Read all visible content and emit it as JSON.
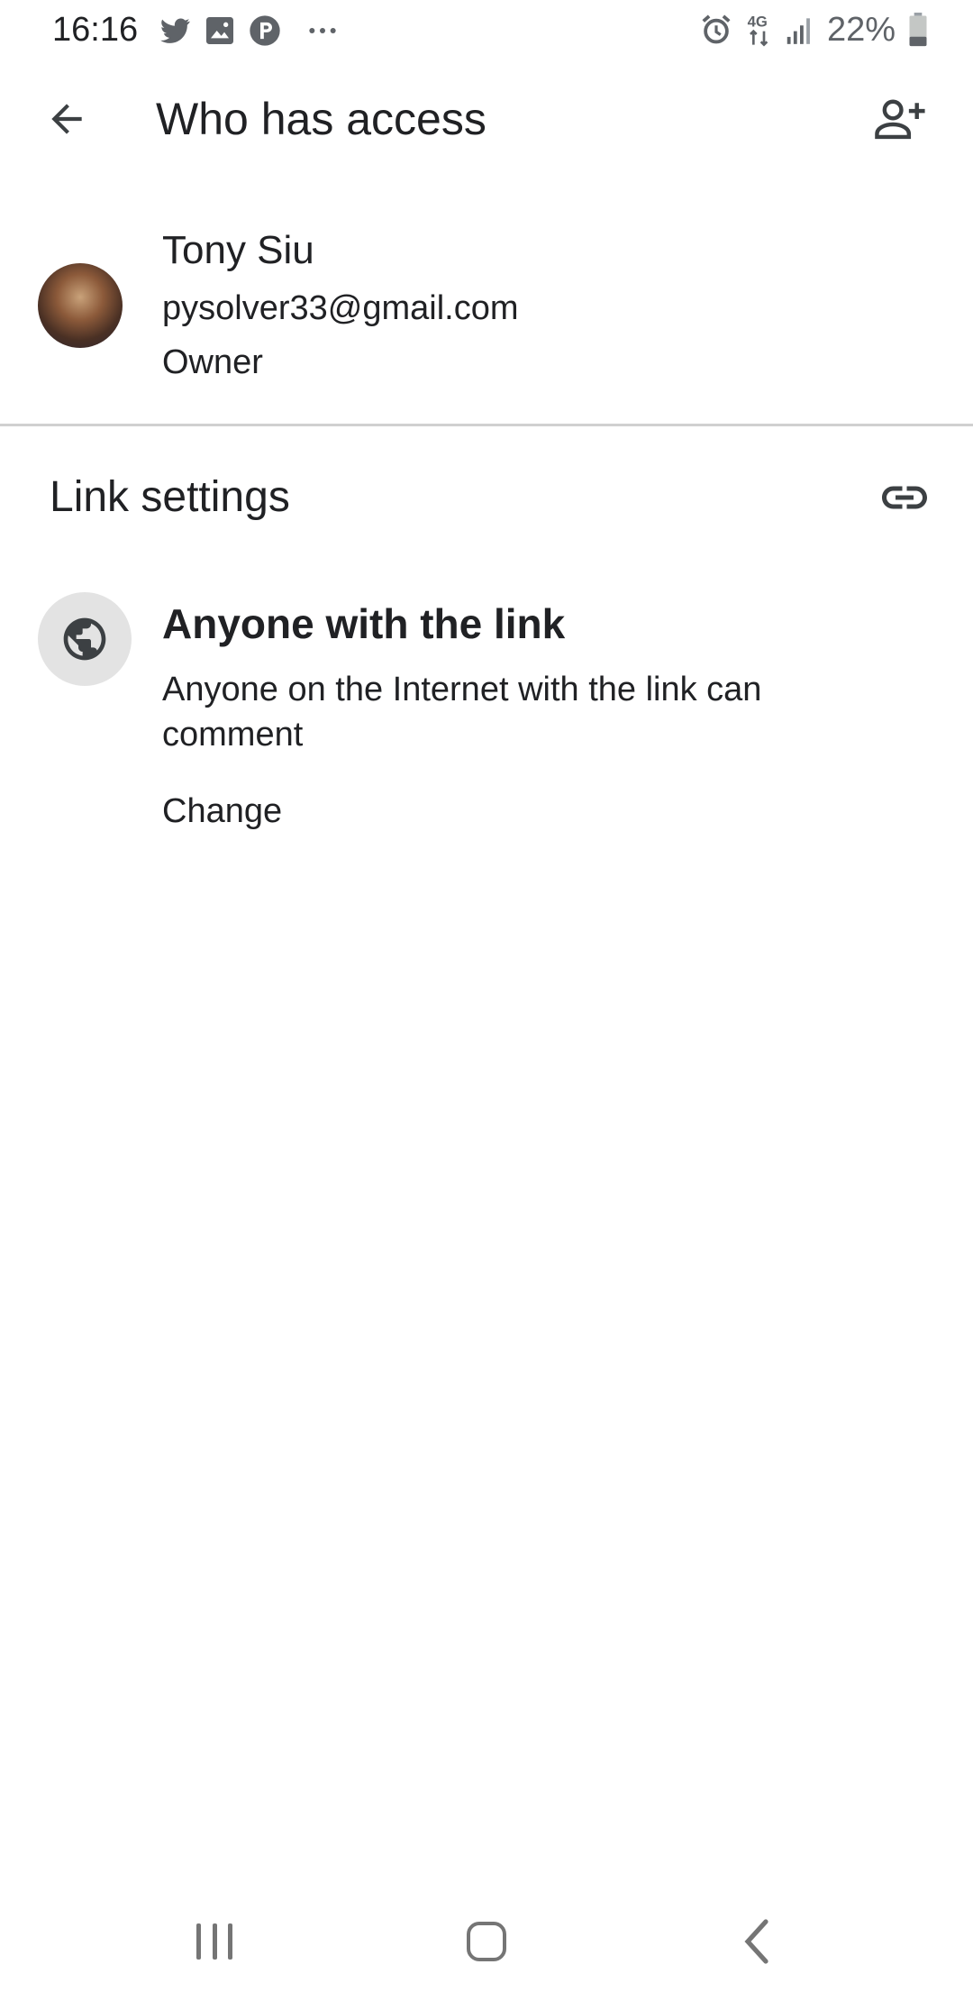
{
  "status_bar": {
    "time": "16:16",
    "battery": "22%",
    "icons": [
      "twitter-icon",
      "gallery-icon",
      "p-app-icon",
      "more-notifications-icon",
      "alarm-icon",
      "4g-icon",
      "signal-icon",
      "battery-icon"
    ]
  },
  "app_bar": {
    "title": "Who has access",
    "back_icon": "arrow-back-icon",
    "add_icon": "add-person-icon"
  },
  "owner": {
    "name": "Tony Siu",
    "email": "pysolver33@gmail.com",
    "role": "Owner"
  },
  "link_settings": {
    "title": "Link settings",
    "icon": "link-icon",
    "access_title": "Anyone with the link",
    "access_description": "Anyone on the Internet with the link can comment",
    "change_label": "Change",
    "access_icon": "globe-icon"
  },
  "nav_bar": {
    "buttons": [
      "recents-icon",
      "home-icon",
      "back-icon"
    ]
  },
  "colors": {
    "text": "#202124",
    "icon": "#3c4043",
    "divider": "#d0d0d0",
    "globe_bg": "#e3e3e3"
  }
}
